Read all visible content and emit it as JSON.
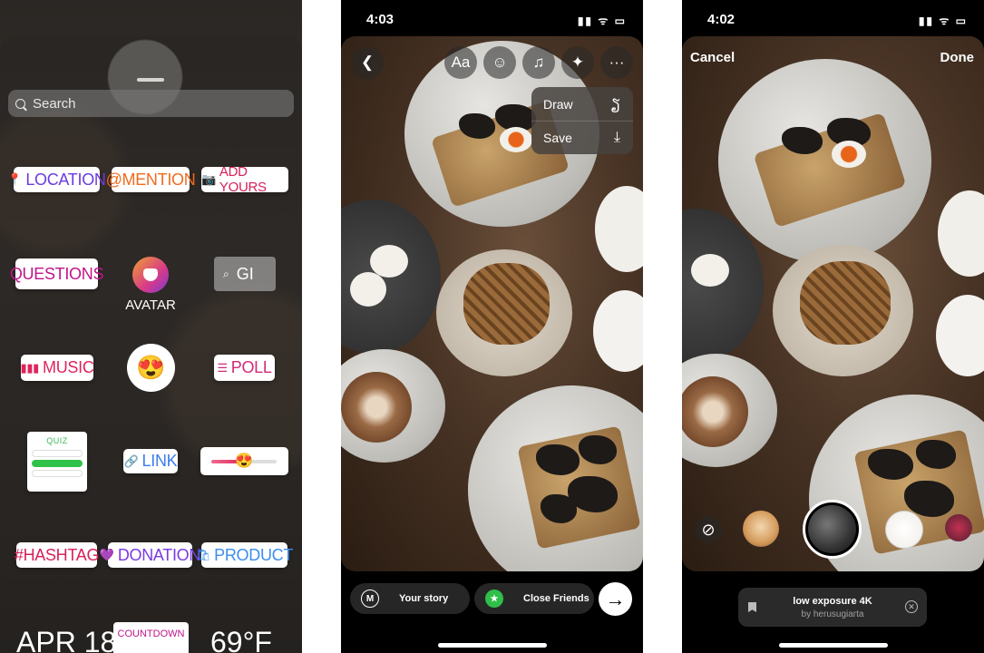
{
  "sticker_tray": {
    "search_placeholder": "Search",
    "stickers": {
      "location": "LOCATION",
      "mention": "@MENTION",
      "add_yours": "ADD YOURS",
      "questions": "QUESTIONS",
      "avatar": "AVATAR",
      "gif": "GI",
      "music": "MUSIC",
      "poll": "POLL",
      "quiz": "QUIZ",
      "link": "LINK",
      "hashtag": "#HASHTAG",
      "donation": "DONATION",
      "product": "PRODUCT",
      "date": "APR 18",
      "countdown": "COUNTDOWN",
      "temperature": "69°F"
    }
  },
  "editor": {
    "status_time": "4:03",
    "toolbar": {
      "text_label": "Aa"
    },
    "menu": {
      "draw": "Draw",
      "save": "Save"
    },
    "share": {
      "your_story": "Your story",
      "close_friends": "Close Friends"
    }
  },
  "effects": {
    "status_time": "4:02",
    "cancel": "Cancel",
    "done": "Done",
    "music_card": {
      "title": "low exposure 4K",
      "artist": "by herusugiarta"
    }
  },
  "colors": {
    "close_friends_green": "#2fbf4a",
    "quiz_green": "#2fc24b"
  }
}
